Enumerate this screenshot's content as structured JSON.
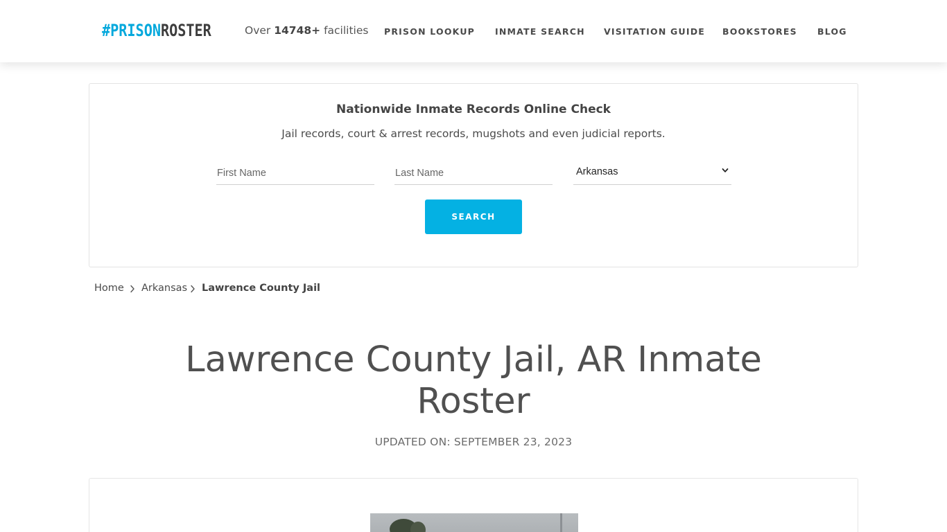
{
  "header": {
    "logo": {
      "hash": "#",
      "prison": "PRISON",
      "roster": "ROSTER"
    },
    "facilities": {
      "prefix": "Over ",
      "count": "14748+",
      "suffix": " facilities"
    },
    "nav": [
      {
        "label": "PRISON LOOKUP"
      },
      {
        "label": "INMATE SEARCH"
      },
      {
        "label": "VISITATION GUIDE"
      },
      {
        "label": "BOOKSTORES"
      },
      {
        "label": "BLOG"
      }
    ]
  },
  "search": {
    "title": "Nationwide Inmate Records Online Check",
    "subtitle": "Jail records, court & arrest records, mugshots and even judicial reports.",
    "first_name_placeholder": "First Name",
    "last_name_placeholder": "Last Name",
    "state_selected": "Arkansas",
    "button_label": "SEARCH"
  },
  "breadcrumb": {
    "home": "Home",
    "state": "Arkansas",
    "current": "Lawrence County Jail"
  },
  "page": {
    "title": "Lawrence County Jail, AR Inmate Roster",
    "updated": "UPDATED ON: SEPTEMBER 23, 2023"
  },
  "colors": {
    "accent": "#04b1e3",
    "logo_blue": "#04a8dc",
    "text": "#4a4a4a"
  },
  "icons": {
    "breadcrumb_separator": "chevron-right-icon",
    "select_arrow": "chevron-down-icon"
  }
}
